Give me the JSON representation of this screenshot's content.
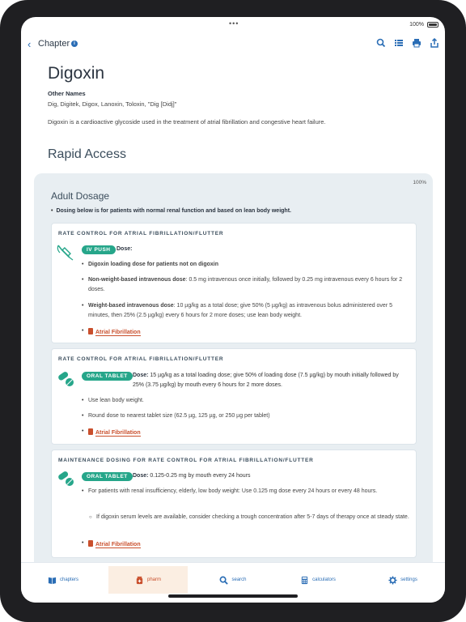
{
  "statusbar": {
    "dots": "•••",
    "battery": "100%"
  },
  "navbar": {
    "back_glyph": "‹",
    "title": "Chapter",
    "info": "i"
  },
  "drug": {
    "title": "Digoxin",
    "other_names_label": "Other Names",
    "other_names": "Dig, Digitek, Digox, Lanoxin, Toloxin, \"Dig [Didj]\"",
    "description": "Digoxin is a cardioactive glycoside used in the treatment of atrial fibrillation and congestive heart failure."
  },
  "rapid_access": {
    "heading": "Rapid Access",
    "version": "100%",
    "section_title": "Adult Dosage",
    "note": "Dosing below is for patients with normal renal function and based on lean body weight."
  },
  "cards": [
    {
      "title": "RATE CONTROL FOR ATRIAL FIBRILLATION/FLUTTER",
      "icon": "syringe-icon",
      "badge": "IV PUSH",
      "dose_label": "Dose:",
      "items": [
        {
          "bold": "Digoxin loading dose for patients not on digoxin",
          "text": ""
        },
        {
          "bold": "Non-weight-based intravenous dose",
          "text": ": 0.5 mg intravenous once initially, followed by 0.25 mg intravenous every 6 hours for 2 doses."
        },
        {
          "bold": "Weight-based intravenous dose",
          "text": ": 10 µg/kg as a total dose; give 50% (5 µg/kg) as intravenous bolus administered over 5 minutes, then 25% (2.5 µg/kg) every 6 hours for 2 more doses; use lean body weight."
        }
      ],
      "link": "Atrial Fibrillation"
    },
    {
      "title": "RATE CONTROL FOR ATRIAL FIBRILLATION/FLUTTER",
      "icon": "pill-icon",
      "badge": "ORAL TABLET",
      "dose_label": "Dose:",
      "dose_text": "15 µg/kg as a total loading dose; give 50% of loading dose (7.5 µg/kg) by mouth initially followed by 25% (3.75 µg/kg) by mouth every 6 hours for 2 more doses.",
      "items": [
        {
          "text": "Use lean body weight."
        },
        {
          "text": "Round dose to nearest tablet size (62.5 µg, 125 µg, or 250 µg per tablet)"
        }
      ],
      "link": "Atrial Fibrillation"
    },
    {
      "title": "MAINTENANCE DOSING FOR RATE CONTROL FOR ATRIAL FIBRILLATION/FLUTTER",
      "icon": "pill-icon",
      "badge": "ORAL TABLET",
      "dose_label": "Dose:",
      "dose_text": "0.125-0.25 mg by mouth every 24 hours",
      "items": [
        {
          "text": "For patients with renal insufficiency, elderly, low body weight: Use 0.125 mg dose every 24 hours or every 48 hours."
        }
      ],
      "sub_items": [
        {
          "text": "If digoxin serum levels are available, consider checking a trough concentration after 5-7 days of therapy once at steady state."
        }
      ],
      "link": "Atrial Fibrillation"
    }
  ],
  "tabs": [
    {
      "label": "chapters",
      "icon": "book-icon",
      "active": false
    },
    {
      "label": "pharm",
      "icon": "pharm-bottle-icon",
      "active": true
    },
    {
      "label": "search",
      "icon": "search-icon",
      "active": false
    },
    {
      "label": "calculators",
      "icon": "calculator-icon",
      "active": false
    },
    {
      "label": "settings",
      "icon": "gear-icon",
      "active": false
    }
  ],
  "colors": {
    "accent": "#2a6db5",
    "badge": "#26a68a",
    "link": "#c94f2c",
    "panel": "#e8eef2"
  }
}
